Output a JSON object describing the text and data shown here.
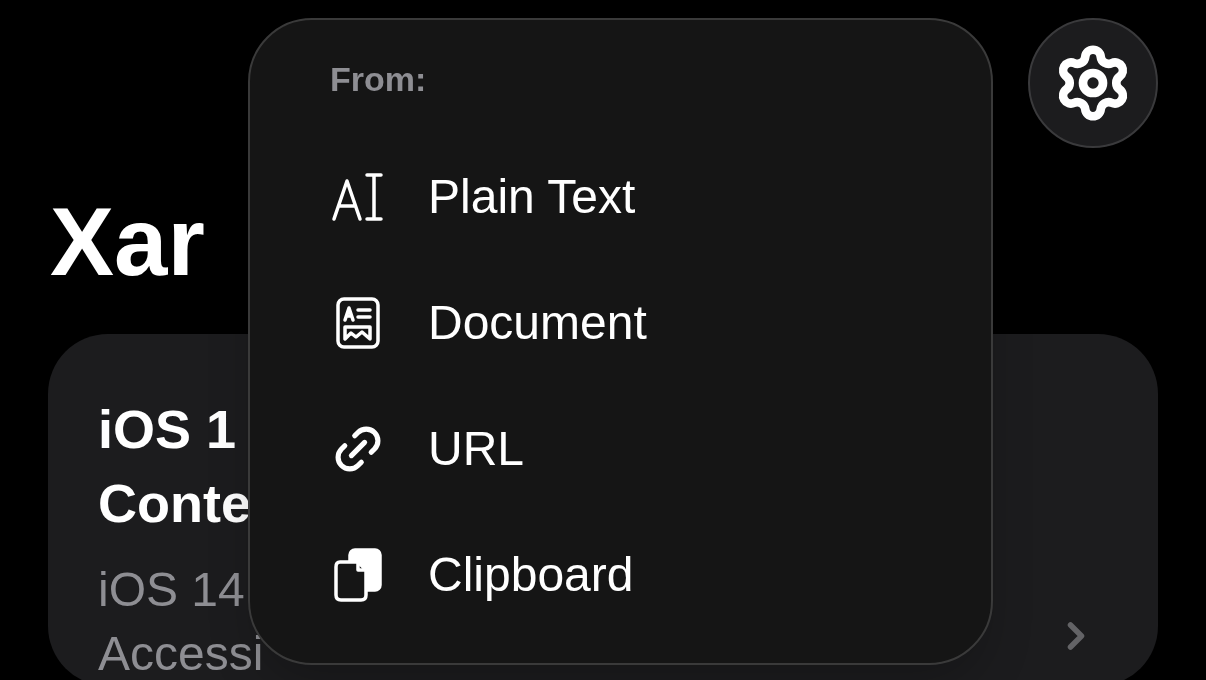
{
  "header": {
    "title": "Xar"
  },
  "card": {
    "title_lines": [
      "iOS 1",
      "Conte"
    ],
    "subtitle_lines": [
      "iOS 14",
      "Accessi"
    ]
  },
  "menu": {
    "heading": "From:",
    "items": [
      {
        "label": "Plain Text",
        "kind": "text"
      },
      {
        "label": "Document",
        "kind": "document"
      },
      {
        "label": "URL",
        "kind": "link"
      },
      {
        "label": "Clipboard",
        "kind": "clipboard"
      }
    ]
  }
}
